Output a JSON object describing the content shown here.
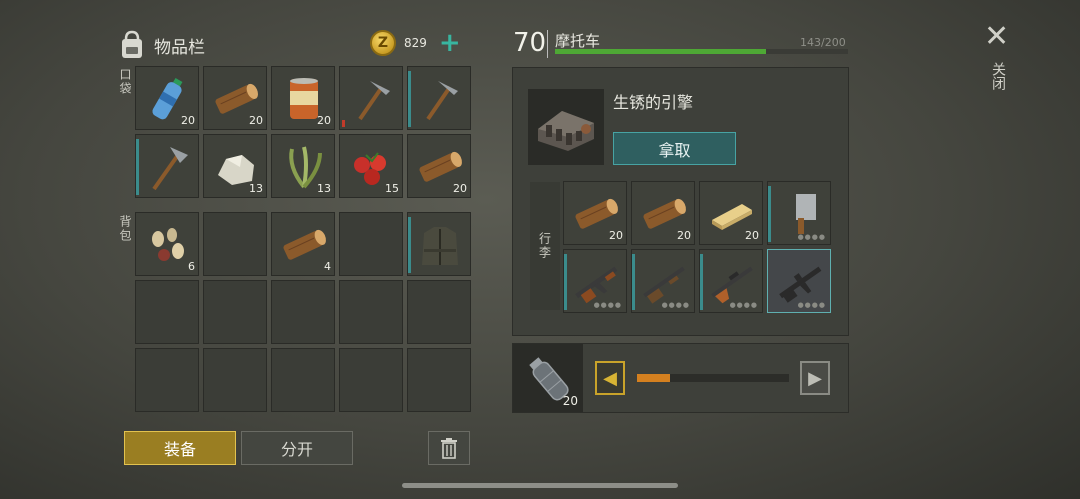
{
  "inventory": {
    "title": "物品栏",
    "coins": "829",
    "coin_symbol": "Z",
    "plus_label": "+",
    "pocket_label": "口袋",
    "backpack_label": "背包",
    "pocket": [
      {
        "name": "water-bottle",
        "count": "20"
      },
      {
        "name": "log",
        "count": "20"
      },
      {
        "name": "canned-food",
        "count": "20"
      },
      {
        "name": "pickaxe",
        "count": ""
      },
      {
        "name": "pickaxe",
        "count": ""
      },
      {
        "name": "hatchet",
        "count": ""
      },
      {
        "name": "stone",
        "count": "13"
      },
      {
        "name": "plant-fiber",
        "count": "13"
      },
      {
        "name": "berries",
        "count": "15"
      },
      {
        "name": "log",
        "count": "20"
      }
    ],
    "backpack": [
      {
        "name": "seeds",
        "count": "6"
      },
      {
        "name": "empty",
        "count": ""
      },
      {
        "name": "log",
        "count": "4"
      },
      {
        "name": "empty",
        "count": ""
      },
      {
        "name": "jacket",
        "count": ""
      }
    ],
    "equip_label": "装备",
    "split_label": "分开"
  },
  "vehicle": {
    "level": "70",
    "name": "摩托车",
    "hp_text": "143/200",
    "hp_fraction": 0.72,
    "engine_label": "生锈的引擎",
    "take_label": "拿取",
    "cargo_label": "行李",
    "cargo": [
      {
        "name": "log",
        "count": "20"
      },
      {
        "name": "log",
        "count": "20"
      },
      {
        "name": "plank",
        "count": "20"
      },
      {
        "name": "cleaver",
        "count": ""
      },
      {
        "name": "ak-rifle",
        "count": ""
      },
      {
        "name": "shotgun",
        "count": ""
      },
      {
        "name": "svd-rifle",
        "count": ""
      },
      {
        "name": "m16-rifle",
        "count": ""
      }
    ]
  },
  "transfer": {
    "item": "water-bottle",
    "count": "20",
    "slider_fraction": 0.22
  },
  "close_label": "关闭",
  "colors": {
    "accent_gold": "#c9a32a",
    "accent_teal": "#47a3a3",
    "hp_green": "#4ea835"
  }
}
